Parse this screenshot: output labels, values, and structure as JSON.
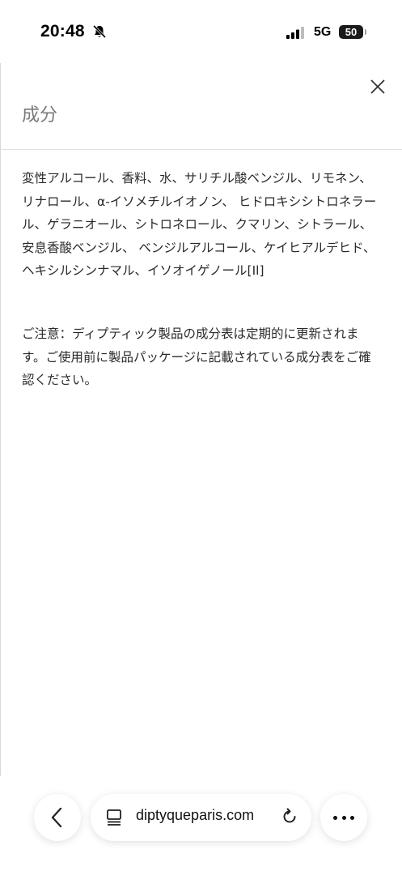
{
  "status_bar": {
    "time": "20:48",
    "network": "5G",
    "battery": "50"
  },
  "sheet": {
    "title": "成分",
    "ingredients": "変性アルコール、香料、水、サリチル酸ベンジル、リモネン、リナロール、α-イソメチルイオノン、 ヒドロキシシトロネラール、ゲラニオール、シトロネロール、クマリン、シトラール、安息香酸ベンジル、 ベンジルアルコール、ケイヒアルデヒド、ヘキシルシンナマル、イソオイゲノール[Il]",
    "notice": "ご注意：ディプティック製品の成分表は定期的に更新されます。ご使用前に製品パッケージに記載されている成分表をご確認ください。"
  },
  "browser": {
    "url": "diptyqueparis.com"
  },
  "icons": {
    "close": "close-icon",
    "back": "chevron-left-icon",
    "tabs": "tabs-icon",
    "reload": "reload-icon",
    "more": "more-icon",
    "silent": "bell-slash-icon",
    "signal": "signal-icon"
  }
}
